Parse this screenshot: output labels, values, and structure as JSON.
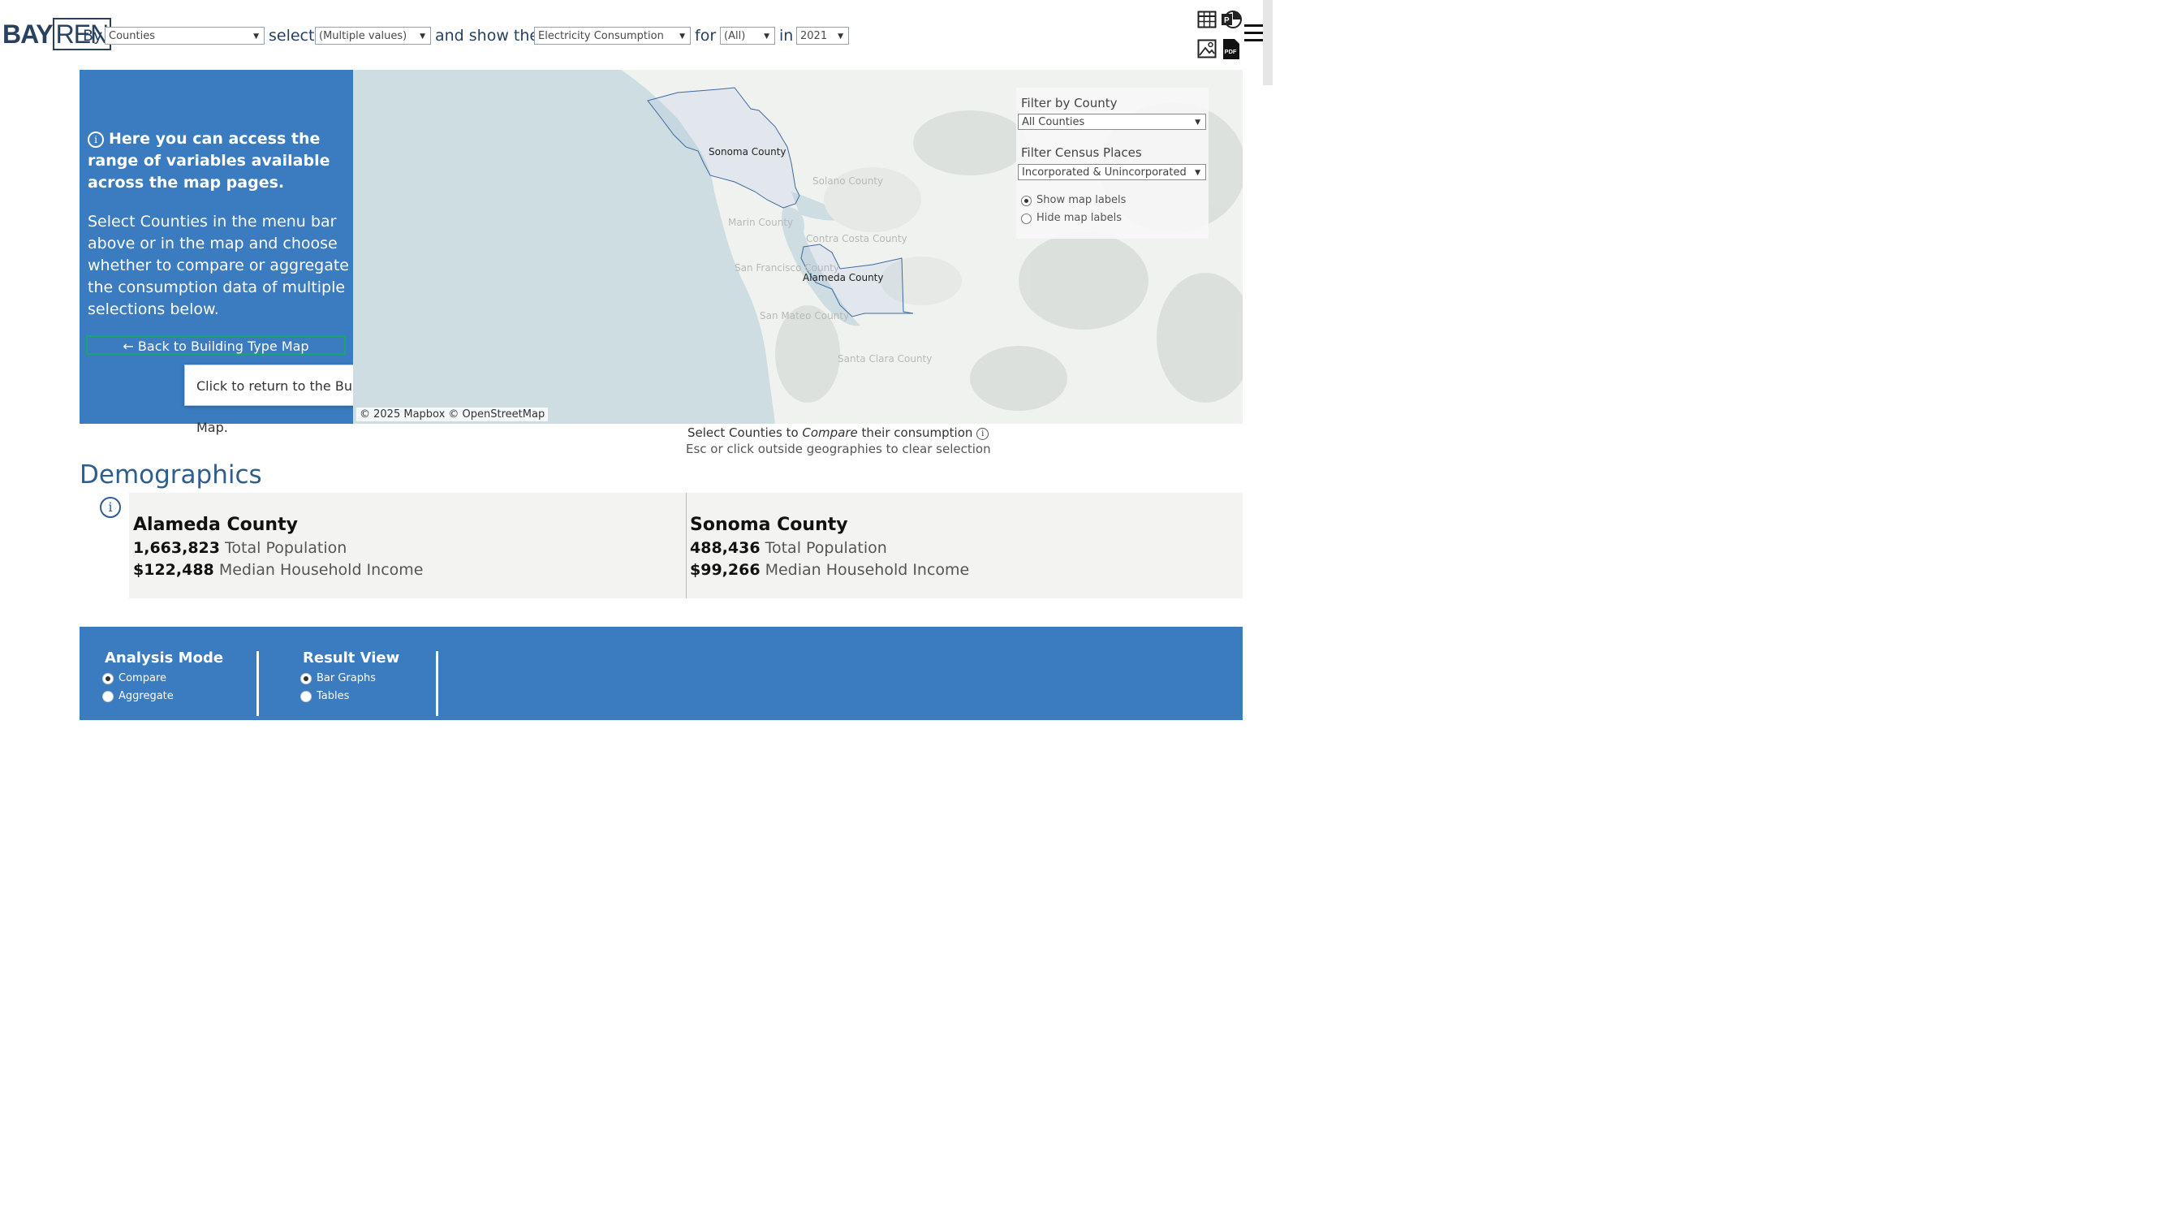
{
  "header": {
    "logo_a": "BAY",
    "logo_b": "REN",
    "word_by": "By",
    "by_value": "Counties",
    "word_select": "select",
    "select_value": "(Multiple values)",
    "word_show": "and show the",
    "show_value": "Electricity Consumption",
    "word_for": "for",
    "for_value": "(All)",
    "word_in": "in",
    "year_value": "2021",
    "icons": [
      "table-icon",
      "powerpoint-icon",
      "image-icon",
      "pdf-icon",
      "menu-icon"
    ]
  },
  "info_panel": {
    "info_text": "Here you can access the range of variables available across the map pages.",
    "body_text": "Select Counties in the menu bar above or in the map and choose whether to compare or aggregate the consumption data of multiple selections below.",
    "back_button": "Back to Building Type Map",
    "tooltip": "Click to return to the Building Type Map."
  },
  "map": {
    "labels": {
      "sonoma": "Sonoma County",
      "solano": "Solano County",
      "marin": "Marin County",
      "contra_costa": "Contra Costa County",
      "san_francisco": "San Francisco County",
      "alameda": "Alameda County",
      "san_mateo": "San Mateo County",
      "santa_clara": "Santa Clara County"
    },
    "credit": "© 2025 Mapbox  © OpenStreetMap",
    "filter_county_title": "Filter by County",
    "filter_county_value": "All Counties",
    "filter_places_title": "Filter Census Places",
    "filter_places_value": "Incorporated & Unincorporated",
    "show_labels": "Show map labels",
    "hide_labels": "Hide map labels"
  },
  "caption": {
    "line1_a": "Select Counties to ",
    "line1_em": "Compare",
    "line1_b": " their consumption",
    "line2": "Esc or click outside geographies to clear selection"
  },
  "demographics": {
    "title": "Demographics",
    "cards": [
      {
        "name": "Alameda County",
        "population": "1,663,823",
        "population_label": "Total Population",
        "income": "$122,488",
        "income_label": "Median Household Income"
      },
      {
        "name": "Sonoma County",
        "population": "488,436",
        "population_label": "Total Population",
        "income": "$99,266",
        "income_label": "Median Household Income"
      }
    ]
  },
  "controls": {
    "analysis_title": "Analysis Mode",
    "analysis_options": [
      "Compare",
      "Aggregate"
    ],
    "result_title": "Result View",
    "result_options": [
      "Bar Graphs",
      "Tables"
    ]
  },
  "colors": {
    "accent_blue": "#3b7bbf",
    "title_blue": "#2e5e8e",
    "button_border": "#1ba56b",
    "water": "#cddde2"
  }
}
